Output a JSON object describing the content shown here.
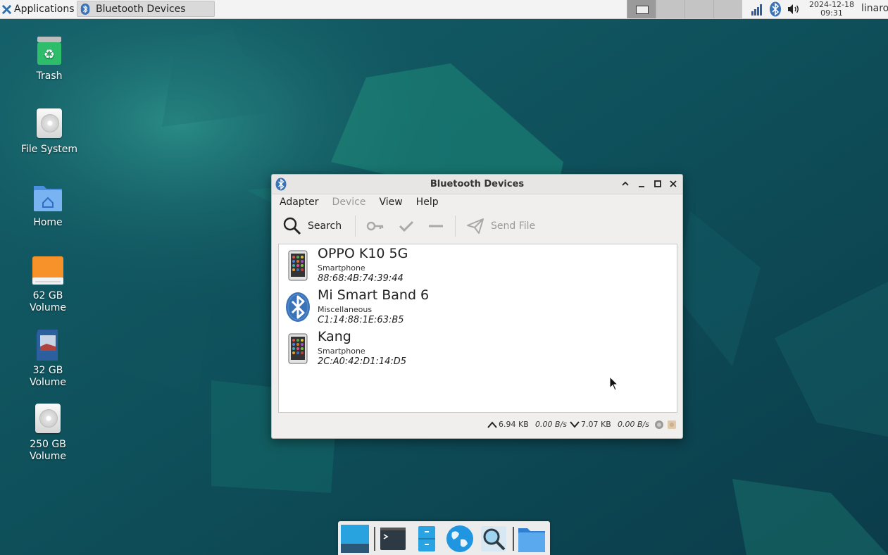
{
  "top_panel": {
    "applications_label": "Applications",
    "menu_separator": "⠇",
    "task_button_label": "Bluetooth Devices",
    "clock_date": "2024-12-18",
    "clock_time": "09:31",
    "user": "linaro",
    "tray_icons": [
      "network-signal-icon",
      "bluetooth-icon",
      "volume-icon"
    ]
  },
  "desktop_icons": [
    {
      "label": "Trash",
      "icon": "trash-icon"
    },
    {
      "label": "File System",
      "icon": "drive-icon"
    },
    {
      "label": "Home",
      "icon": "home-folder-icon"
    },
    {
      "label": "62 GB\nVolume",
      "icon": "drive-icon"
    },
    {
      "label": "32 GB\nVolume",
      "icon": "sd-card-icon"
    },
    {
      "label": "250 GB\nVolume",
      "icon": "drive-icon"
    }
  ],
  "window": {
    "title": "Bluetooth Devices",
    "menu": [
      "Adapter",
      "Device",
      "View",
      "Help"
    ],
    "disabled_menu": [
      "Device"
    ],
    "toolbar": {
      "search_label": "Search",
      "send_file_label": "Send File"
    },
    "devices": [
      {
        "name": "OPPO K10 5G",
        "type": "Smartphone",
        "address": "88:68:4B:74:39:44",
        "icon": "smartphone-icon"
      },
      {
        "name": "Mi Smart Band 6",
        "type": "Miscellaneous",
        "address": "C1:14:88:1E:63:B5",
        "icon": "bluetooth-icon"
      },
      {
        "name": "Kang",
        "type": "Smartphone",
        "address": "2C:A0:42:D1:14:D5",
        "icon": "smartphone-icon"
      }
    ],
    "status": {
      "upload_total": "6.94 KB",
      "upload_rate": "0.00 B/s",
      "download_total": "7.07 KB",
      "download_rate": "0.00 B/s"
    }
  },
  "dock_items": [
    "show-desktop-icon",
    "terminal-icon",
    "file-manager-icon",
    "web-browser-icon",
    "app-finder-icon",
    "folder-icon"
  ],
  "colors": {
    "bluetooth_blue": "#3b73b9",
    "accent_teal": "#1d8a7a"
  }
}
